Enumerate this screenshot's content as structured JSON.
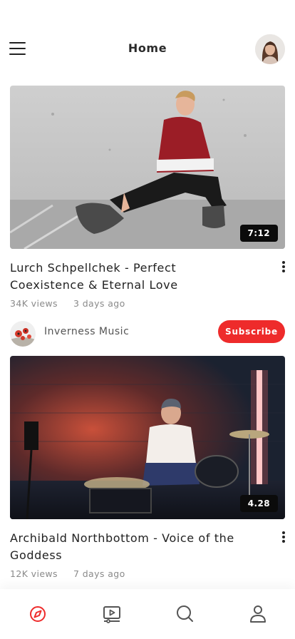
{
  "header": {
    "title": "Home",
    "menu_icon": "hamburger-menu-icon",
    "avatar": "user-avatar"
  },
  "videos": [
    {
      "title": "Lurch Schpellchek - Perfect Coexistence & Eternal Love",
      "duration": "7:12",
      "views": "34K views",
      "ago": "3 days ago",
      "channel": {
        "name": "Inverness Music",
        "subscribe_label": "Subscribe"
      }
    },
    {
      "title": "Archibald Northbottom - Voice of the Goddess",
      "duration": "4.28",
      "views": "12K views",
      "ago": "7 days ago"
    }
  ],
  "tabs": [
    {
      "name": "explore",
      "icon": "compass-icon",
      "active": true
    },
    {
      "name": "subscriptions",
      "icon": "video-player-icon",
      "active": false
    },
    {
      "name": "search",
      "icon": "search-icon",
      "active": false
    },
    {
      "name": "profile",
      "icon": "user-icon",
      "active": false
    }
  ],
  "colors": {
    "accent": "#ee2b2b",
    "text": "#222222",
    "muted": "#8a8a8a",
    "tab_inactive": "#555555"
  }
}
